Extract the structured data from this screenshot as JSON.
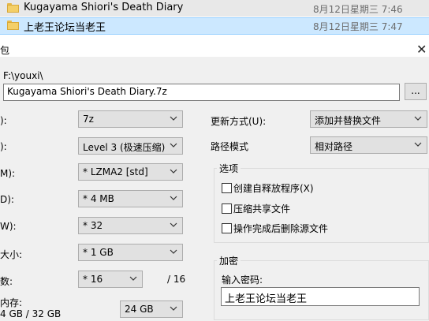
{
  "explorer": {
    "files": [
      {
        "name": "Kugayama Shiori's Death Diary",
        "date": "8月12日星期三 7:46",
        "selected": false
      },
      {
        "name": "上老王论坛当老王",
        "date": "8月12日星期三 7:47",
        "selected": true
      }
    ]
  },
  "dialog": {
    "title_fragment": "包",
    "path_label": "F:\\youxi\\",
    "archive_name": "Kugayama Shiori's Death Diary.7z",
    "browse_label": "...",
    "left_labels": [
      "):",
      "):",
      "M):",
      "D):",
      "W):",
      "大小:",
      "数:",
      "内存:"
    ],
    "format_value": "7z",
    "level_value": "Level 3 (极速压缩)",
    "method_value": "* LZMA2 [std]",
    "dict_value": "* 4 MB",
    "word_value": "* 32",
    "solid_value": "* 1 GB",
    "threads_value": "* 16",
    "threads_total": "/ 16",
    "memory_usage": "4 GB / 32 GB",
    "memory_value": "24 GB",
    "update_label": "更新方式(U):",
    "update_value": "添加并替换文件",
    "path_mode_label": "路径模式",
    "path_mode_value": "相对路径",
    "options_title": "选项",
    "options": [
      {
        "label": "创建自释放程序(X)",
        "checked": false
      },
      {
        "label": "压缩共享文件",
        "checked": false
      },
      {
        "label": "操作完成后删除源文件",
        "checked": false
      }
    ],
    "encrypt_title": "加密",
    "password_label": "输入密码:",
    "password_value": "上老王论坛当老王"
  },
  "icons": {
    "folder": "folder-icon",
    "dropdown": "chevron-down-icon",
    "close": "close-icon"
  }
}
